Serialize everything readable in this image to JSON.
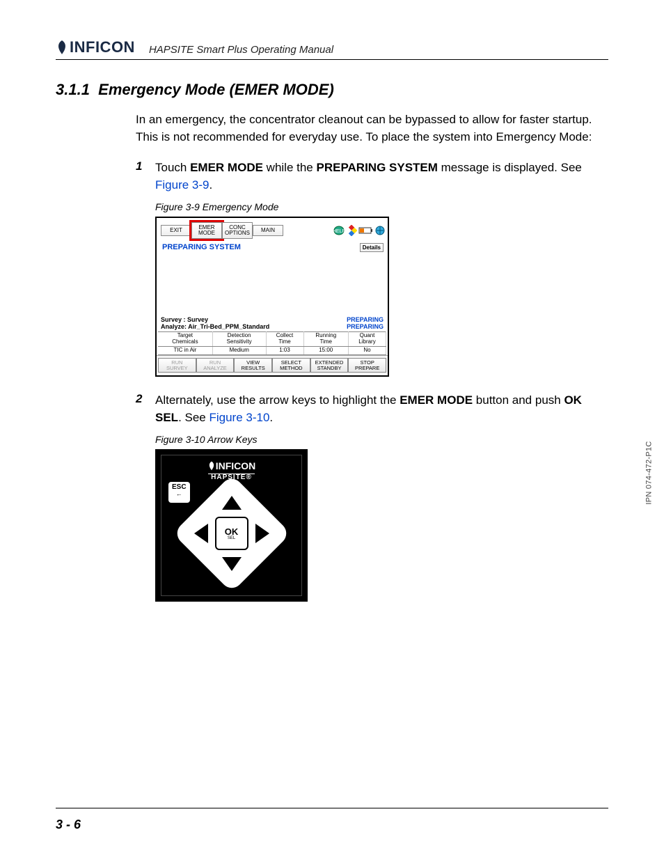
{
  "header": {
    "logo_text": "INFICON",
    "doc_title": "HAPSITE Smart Plus Operating Manual"
  },
  "section": {
    "number": "3.1.1",
    "title": "Emergency Mode (EMER MODE)"
  },
  "intro_para": "In an emergency, the concentrator cleanout can be bypassed to allow for faster startup. This is not recommended for everyday use. To place the system into Emergency Mode:",
  "steps": [
    {
      "num": "1",
      "pre": "Touch ",
      "b1": "EMER MODE",
      "mid": " while the ",
      "b2": "PREPARING SYSTEM",
      "post": " message is displayed. See ",
      "link": "Figure 3-9",
      "end": "."
    },
    {
      "num": "2",
      "pre": "Alternately, use the arrow keys to highlight the ",
      "b1": "EMER MODE",
      "mid": " button and push ",
      "b2": "OK SEL",
      "post": ". See ",
      "link": "Figure 3-10",
      "end": "."
    }
  ],
  "fig39": {
    "caption": "Figure 3-9  Emergency Mode",
    "top_buttons": [
      "EXIT",
      "EMER\nMODE",
      "CONC\nOPTIONS",
      "MAIN"
    ],
    "status": "PREPARING SYSTEM",
    "details": "Details",
    "survey_line1_left": "Survey : Survey",
    "survey_line1_right": "PREPARING",
    "survey_line2_left": "Analyze: Air_Tri-Bed_PPM_Standard",
    "survey_line2_right": "PREPARING",
    "table_headers": [
      "Target\nChemicals",
      "Detection\nSensitivity",
      "Collect\nTime",
      "Running\nTime",
      "Quant\nLibrary"
    ],
    "table_row": [
      "TIC in Air",
      "Medium",
      "1:03",
      "15:00",
      "No"
    ],
    "bottom_buttons": [
      "RUN\nSURVEY",
      "RUN\nANALYZE",
      "VIEW\nRESULTS",
      "SELECT\nMETHOD",
      "EXTENDED\nSTANDBY",
      "STOP\nPREPARE"
    ]
  },
  "fig310": {
    "caption": "Figure 3-10  Arrow Keys",
    "logo": "INFICON",
    "sub": "HAPSITE®",
    "esc": "ESC",
    "ok": "OK",
    "ok_sub": "SEL"
  },
  "footer": {
    "page": "3 - 6",
    "ipn": "IPN 074-472-P1C"
  }
}
